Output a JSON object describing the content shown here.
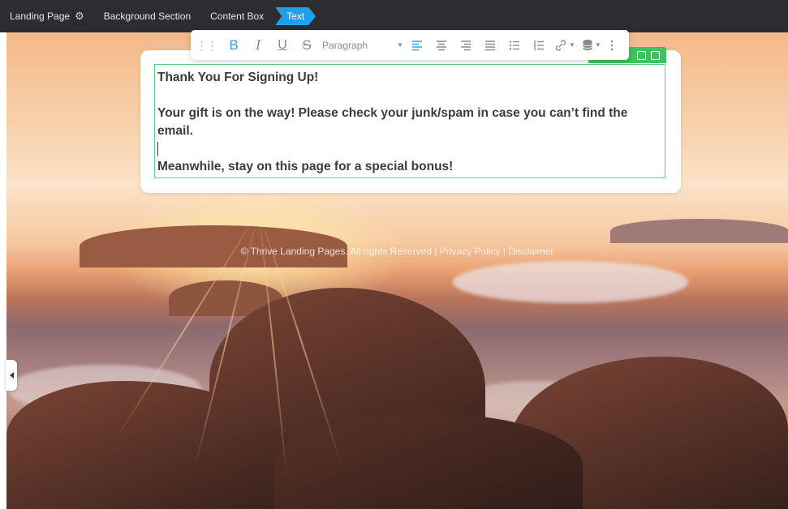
{
  "breadcrumbs": [
    {
      "label": "Landing Page"
    },
    {
      "label": "Background Section"
    },
    {
      "label": "Content Box"
    },
    {
      "label": "Text"
    }
  ],
  "toolbar": {
    "bold": "B",
    "italic": "I",
    "underline": "U",
    "strike": "S",
    "paragraph_label": "Paragraph"
  },
  "content": {
    "heading": "Thank You For Signing Up!",
    "line1": "Your gift is on the way! Please check your junk/spam in case you can’t find the email.",
    "line2": "Meanwhile, stay on this page for a special bonus!"
  },
  "footer": {
    "text": "© Thrive Landing Pages. All rights Reserved | Privacy Policy | Disclaimer"
  },
  "colors": {
    "accent": "#1fa0e8",
    "selection": "#3fc260",
    "topbar": "#2b2d31"
  }
}
